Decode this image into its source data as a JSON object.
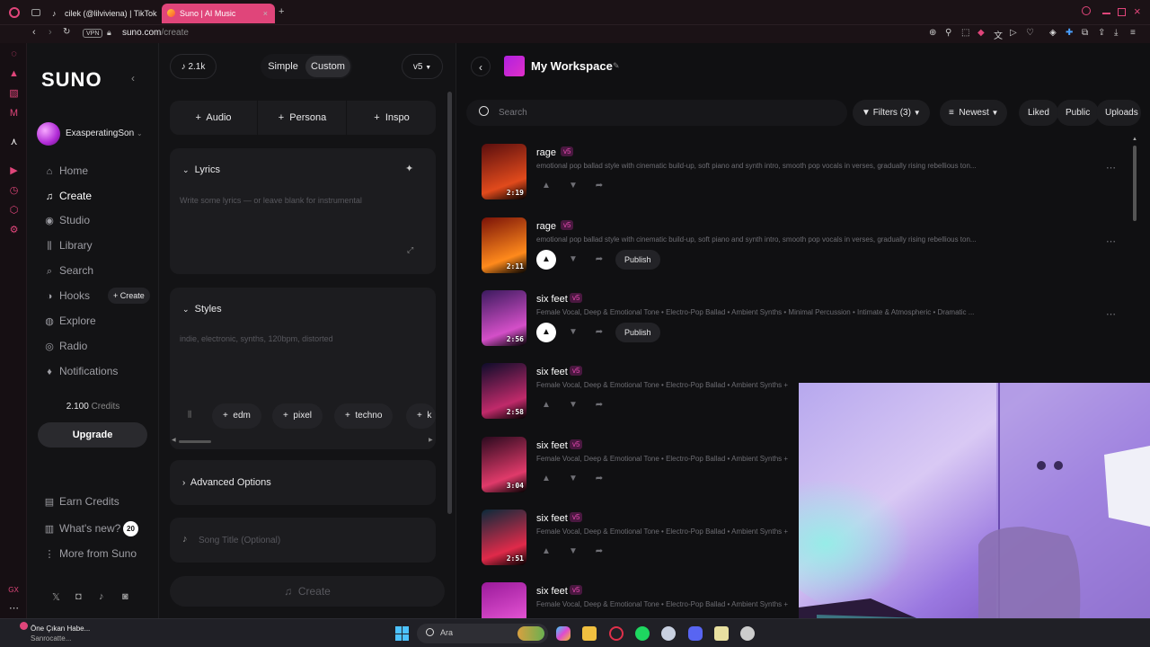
{
  "browser": {
    "tabs": [
      {
        "title": "cilek (@lilviviena) | TikTok",
        "active": false
      },
      {
        "title": "Suno | AI Music",
        "active": true
      }
    ],
    "vpn_label": "VPN",
    "url_host": "suno.com",
    "url_path": "/create",
    "accent_color": "#e0457a"
  },
  "nav": {
    "logo": "SUNO",
    "username": "ExasperatingSon",
    "items": [
      {
        "label": "Home",
        "icon": "home-icon",
        "glyph": "⌂"
      },
      {
        "label": "Create",
        "icon": "create-icon",
        "glyph": "♫"
      },
      {
        "label": "Studio",
        "icon": "studio-icon",
        "glyph": "◉"
      },
      {
        "label": "Library",
        "icon": "library-icon",
        "glyph": "⫼"
      },
      {
        "label": "Search",
        "icon": "search-icon",
        "glyph": "⌕"
      },
      {
        "label": "Hooks",
        "icon": "hooks-icon",
        "glyph": "◑"
      },
      {
        "label": "Explore",
        "icon": "explore-icon",
        "glyph": "◍"
      },
      {
        "label": "Radio",
        "icon": "radio-icon",
        "glyph": "◎"
      },
      {
        "label": "Notifications",
        "icon": "bell-icon",
        "glyph": "♦"
      }
    ],
    "hooks_create_label": "Create",
    "credits_value": "2.100",
    "credits_label": "Credits",
    "upgrade_label": "Upgrade",
    "bottom_items": [
      {
        "label": "Earn Credits",
        "icon": "earn-credits-icon",
        "glyph": "▤"
      },
      {
        "label": "What's new?",
        "icon": "whats-new-icon",
        "glyph": "▥"
      },
      {
        "label": "More from Suno",
        "icon": "more-icon",
        "glyph": "⋮"
      }
    ],
    "whats_new_count": "20"
  },
  "create": {
    "count": "2.1k",
    "mode_simple": "Simple",
    "mode_custom": "Custom",
    "version": "v5",
    "add_audio": "Audio",
    "add_persona": "Persona",
    "add_inspo": "Inspo",
    "lyrics_label": "Lyrics",
    "lyrics_placeholder": "Write some lyrics — or leave blank for instrumental",
    "styles_label": "Styles",
    "styles_placeholder": "indie, electronic, synths, 120bpm, distorted",
    "style_tags": [
      "edm",
      "pixel",
      "techno",
      "k"
    ],
    "advanced_label": "Advanced Options",
    "song_title_placeholder": "Song Title (Optional)",
    "create_button": "Create"
  },
  "workspace": {
    "title": "My Workspace",
    "search_placeholder": "Search",
    "filters_label": "Filters (3)",
    "sort_label": "Newest",
    "liked_label": "Liked",
    "public_label": "Public",
    "uploads_label": "Uploads",
    "songs": [
      {
        "title": "rage",
        "version": "v5",
        "duration": "2:19",
        "desc": "emotional pop ballad style with cinematic build-up, soft piano and synth intro, smooth pop vocals in verses, gradually rising rebellious ton...",
        "liked": false,
        "publish": false,
        "c1": "#5a0e0e",
        "c2": "#e14a1c"
      },
      {
        "title": "rage",
        "version": "v5",
        "duration": "2:11",
        "desc": "emotional pop ballad style with cinematic build-up, soft piano and synth intro, smooth pop vocals in verses, gradually rising rebellious ton...",
        "liked": true,
        "publish": true,
        "c1": "#7a1208",
        "c2": "#ff8a1c"
      },
      {
        "title": "six feet",
        "version": "v5",
        "duration": "2:56",
        "desc": "Female Vocal, Deep & Emotional Tone • Electro-Pop Ballad • Ambient Synths • Minimal Percussion • Intimate & Atmospheric • Dramatic ...",
        "liked": true,
        "publish": true,
        "c1": "#3b1a5e",
        "c2": "#d44fc8"
      },
      {
        "title": "six feet",
        "version": "v5",
        "duration": "2:58",
        "desc": "Female Vocal, Deep & Emotional Tone • Electro-Pop Ballad • Ambient Synths +",
        "liked": false,
        "publish": false,
        "c1": "#0d0c2a",
        "c2": "#c02a6a"
      },
      {
        "title": "six feet",
        "version": "v5",
        "duration": "3:04",
        "desc": "Female Vocal, Deep & Emotional Tone • Electro-Pop Ballad • Ambient Synths +",
        "liked": false,
        "publish": false,
        "c1": "#2a0a1e",
        "c2": "#e03a6a"
      },
      {
        "title": "six feet",
        "version": "v5",
        "duration": "2:51",
        "desc": "Female Vocal, Deep & Emotional Tone • Electro-Pop Ballad • Ambient Synths +",
        "liked": false,
        "publish": false,
        "c1": "#0a2a3a",
        "c2": "#e02a4a"
      },
      {
        "title": "six feet",
        "version": "v5",
        "duration": "",
        "desc": "Female Vocal, Deep & Emotional Tone • Electro-Pop Ballad • Ambient Synths +",
        "liked": false,
        "publish": false,
        "c1": "#9a1a9a",
        "c2": "#e050d0"
      }
    ],
    "publish_label": "Publish"
  },
  "taskbar": {
    "news_label": "Öne Çıkan Habe...",
    "news_sub": "Sanrocatte...",
    "search_placeholder": "Ara"
  }
}
